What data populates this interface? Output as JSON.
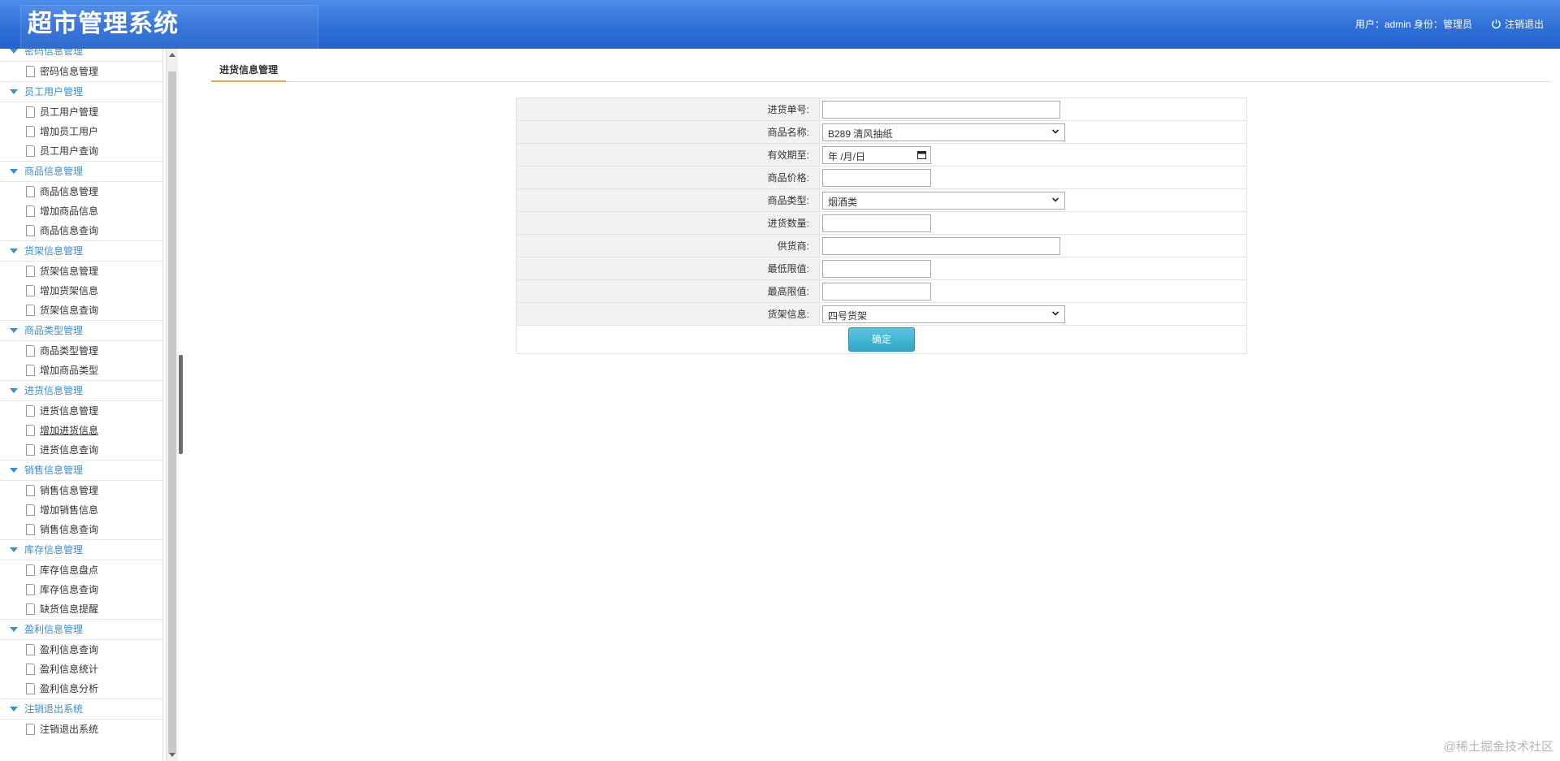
{
  "header": {
    "title": "超市管理系统",
    "user_info": "用户：admin 身份：管理员",
    "logout_label": "注销退出"
  },
  "sidebar": {
    "groups": [
      {
        "title": "密码信息管理",
        "items": [
          "密码信息管理"
        ]
      },
      {
        "title": "员工用户管理",
        "items": [
          "员工用户管理",
          "增加员工用户",
          "员工用户查询"
        ]
      },
      {
        "title": "商品信息管理",
        "items": [
          "商品信息管理",
          "增加商品信息",
          "商品信息查询"
        ]
      },
      {
        "title": "货架信息管理",
        "items": [
          "货架信息管理",
          "增加货架信息",
          "货架信息查询"
        ]
      },
      {
        "title": "商品类型管理",
        "items": [
          "商品类型管理",
          "增加商品类型"
        ]
      },
      {
        "title": "进货信息管理",
        "items": [
          "进货信息管理",
          "增加进货信息",
          "进货信息查询"
        ]
      },
      {
        "title": "销售信息管理",
        "items": [
          "销售信息管理",
          "增加销售信息",
          "销售信息查询"
        ]
      },
      {
        "title": "库存信息管理",
        "items": [
          "库存信息盘点",
          "库存信息查询",
          "缺货信息提醒"
        ]
      },
      {
        "title": "盈利信息管理",
        "items": [
          "盈利信息查询",
          "盈利信息统计",
          "盈利信息分析"
        ]
      },
      {
        "title": "注销退出系统",
        "items": [
          "注销退出系统"
        ]
      }
    ]
  },
  "main": {
    "tab_label": "进货信息管理",
    "form": {
      "purchase_no_label": "进货单号:",
      "product_name_label": "商品名称:",
      "product_name_value": "B289 清风抽纸",
      "expiry_label": "有效期至:",
      "expiry_placeholder": "年 /月/日",
      "price_label": "商品价格:",
      "type_label": "商品类型:",
      "type_value": "烟酒类",
      "quantity_label": "进货数量:",
      "supplier_label": "供货商:",
      "min_label": "最低限值:",
      "max_label": "最高限值:",
      "shelf_label": "货架信息:",
      "shelf_value": "四号货架",
      "submit_label": "确定"
    }
  },
  "watermark": "@稀土掘金技术社区"
}
